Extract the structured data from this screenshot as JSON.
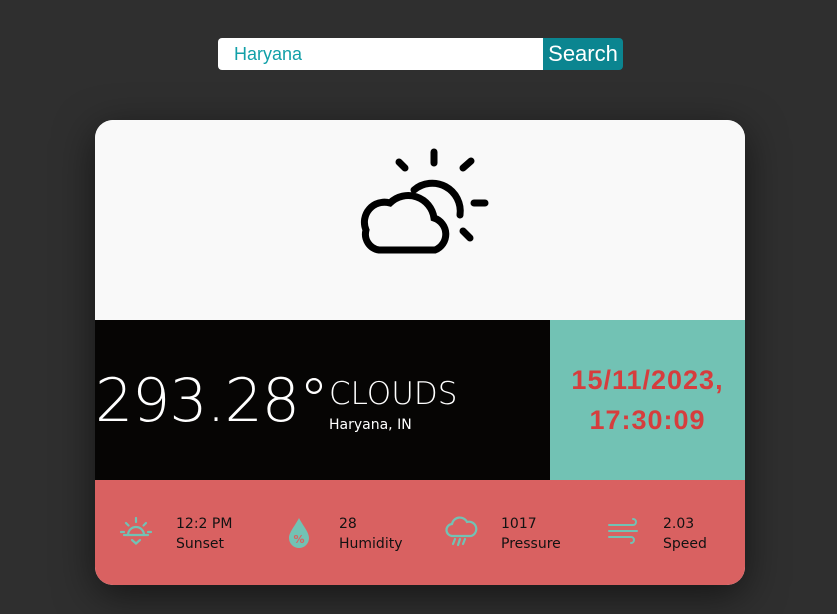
{
  "search": {
    "value": "Haryana",
    "button_label": "Search"
  },
  "weather": {
    "icon": "partly-cloudy-icon",
    "temperature": "293.28°",
    "condition": "CLOUDS",
    "location": "Haryana, IN",
    "datetime_line1": "15/11/2023,",
    "datetime_line2": "17:30:09"
  },
  "stats": [
    {
      "icon": "sunset-icon",
      "value": "12:2 PM",
      "label": "Sunset"
    },
    {
      "icon": "humidity-icon",
      "value": "28",
      "label": "Humidity"
    },
    {
      "icon": "pressure-icon",
      "value": "1017",
      "label": "Pressure"
    },
    {
      "icon": "wind-icon",
      "value": "2.03",
      "label": "Speed"
    }
  ],
  "colors": {
    "background": "#2f2f2f",
    "search_button": "#0b8590",
    "search_text": "#12a0a8",
    "temp_panel": "#060504",
    "date_panel": "#72c2b4",
    "date_text": "#d63d3d",
    "stats_panel": "#d96161",
    "stat_icon": "#72c2b4"
  }
}
